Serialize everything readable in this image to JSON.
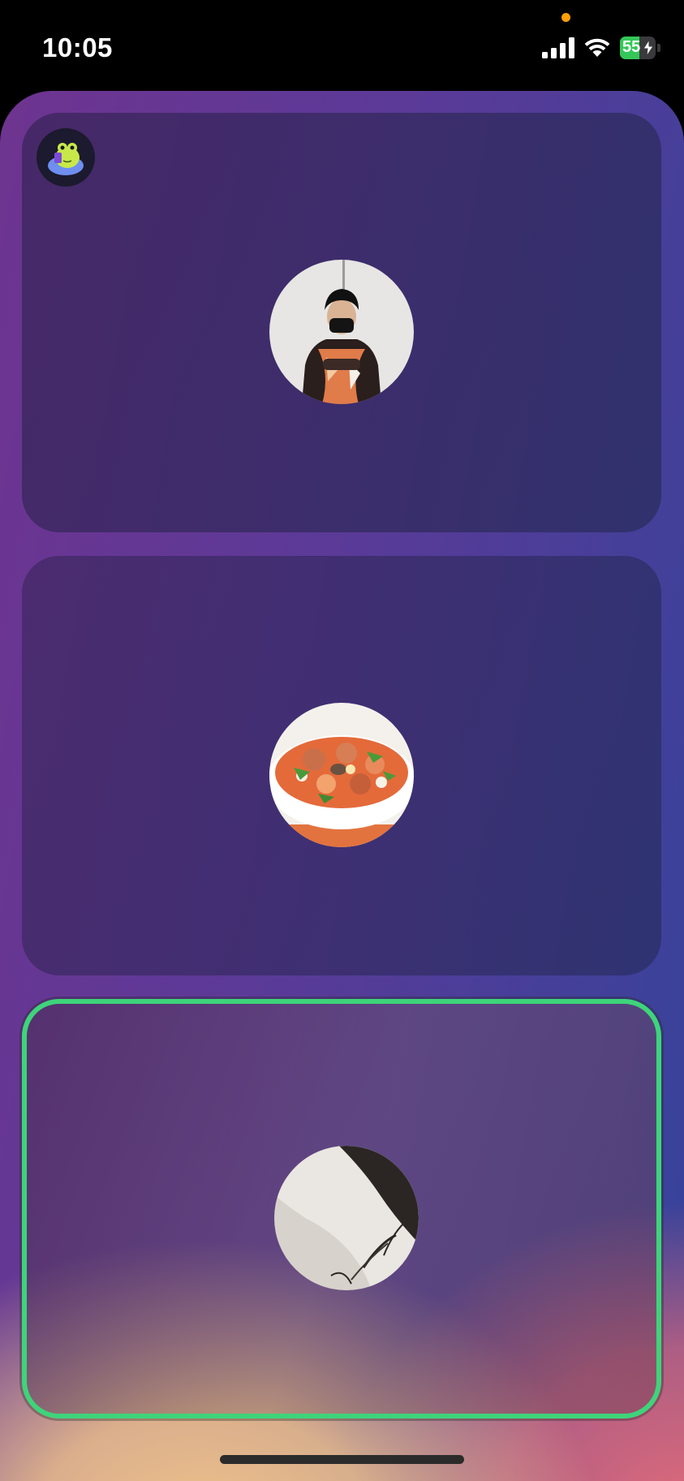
{
  "status_bar": {
    "time": "10:05",
    "battery_level": "55",
    "battery_percent": 55,
    "charging": true
  },
  "colors": {
    "active_speaker_border": "#3ed47a",
    "privacy_indicator": "#ff9f0a",
    "battery_fill": "#34c759"
  },
  "participants": [
    {
      "avatar": "person-in-patterned-shirt-photo",
      "active_speaker": false
    },
    {
      "avatar": "seafood-soup-bowl-photo",
      "active_speaker": false
    },
    {
      "avatar": "close-up-hair-photo",
      "active_speaker": true
    }
  ],
  "host_badge_icon": "frog-mascot-icon"
}
